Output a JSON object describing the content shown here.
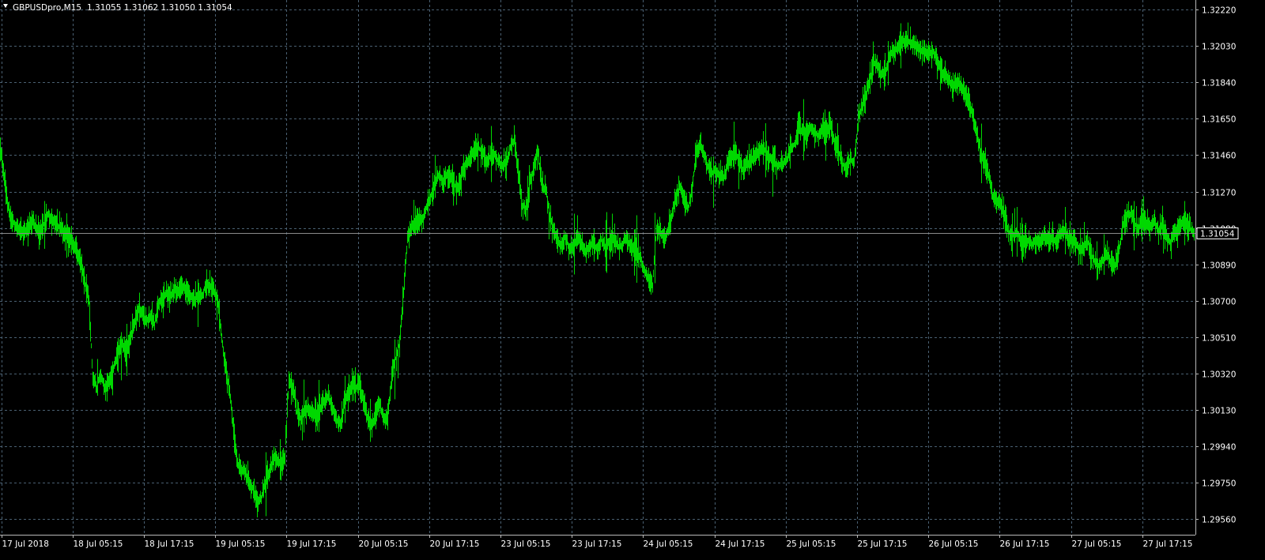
{
  "header": {
    "symbol_timeframe": "GBPUSDpro,M15",
    "ohlc": "1.31055 1.31062 1.31050 1.31054",
    "menu_arrow_icon": "triangle-down-icon"
  },
  "current_price_label": "1.31054",
  "colors": {
    "background": "#000000",
    "bars": "#00d800",
    "grid": "#4a6072",
    "axis": "#b8b8b8",
    "text": "#ffffff",
    "price_tag_bg": "#000000"
  },
  "chart_data": {
    "type": "line",
    "style": "ohlc-bars",
    "timeframe": "M15",
    "title": "GBPUSDpro,M15",
    "grid": true,
    "y_axis": {
      "side": "right",
      "ticks": [
        "1.32220",
        "1.32030",
        "1.31840",
        "1.31650",
        "1.31460",
        "1.31270",
        "1.31080",
        "1.30890",
        "1.30700",
        "1.30510",
        "1.30320",
        "1.30130",
        "1.29940",
        "1.29750",
        "1.29560"
      ],
      "range": [
        1.2953,
        1.3228
      ]
    },
    "x_axis": {
      "ticks": [
        "17 Jul 2018",
        "18 Jul 05:15",
        "18 Jul 17:15",
        "19 Jul 05:15",
        "19 Jul 17:15",
        "20 Jul 05:15",
        "20 Jul 17:15",
        "23 Jul 05:15",
        "23 Jul 17:15",
        "24 Jul 05:15",
        "24 Jul 17:15",
        "25 Jul 05:15",
        "25 Jul 17:15",
        "26 Jul 05:15",
        "26 Jul 17:15",
        "27 Jul 05:15",
        "27 Jul 17:15"
      ]
    },
    "current_price": 1.31054,
    "series": [
      {
        "x": [
          "17 Jul 2018",
          "18 Jul 05:15",
          "18 Jul 17:15",
          "19 Jul 05:15",
          "19 Jul 17:15",
          "20 Jul 05:15",
          "20 Jul 17:15",
          "23 Jul 05:15",
          "23 Jul 17:15",
          "24 Jul 05:15",
          "24 Jul 17:15",
          "25 Jul 05:15",
          "25 Jul 17:15",
          "26 Jul 05:15",
          "26 Jul 17:15",
          "27 Jul 05:15",
          "27 Jul 17:15"
        ],
        "path": [
          [
            0,
            1.315
          ],
          [
            10,
            1.3118
          ],
          [
            20,
            1.3108
          ],
          [
            30,
            1.3105
          ],
          [
            40,
            1.3112
          ],
          [
            50,
            1.3105
          ],
          [
            60,
            1.3115
          ],
          [
            70,
            1.311
          ],
          [
            80,
            1.3106
          ],
          [
            90,
            1.3101
          ],
          [
            100,
            1.3092
          ],
          [
            107,
            1.308
          ],
          [
            112,
            1.307
          ],
          [
            117,
            1.303
          ],
          [
            122,
            1.3025
          ],
          [
            127,
            1.3032
          ],
          [
            132,
            1.3024
          ],
          [
            140,
            1.303
          ],
          [
            145,
            1.3038
          ],
          [
            150,
            1.3045
          ],
          [
            155,
            1.3047
          ],
          [
            160,
            1.3044
          ],
          [
            165,
            1.3052
          ],
          [
            170,
            1.3058
          ],
          [
            175,
            1.3066
          ],
          [
            180,
            1.3062
          ],
          [
            185,
            1.306
          ],
          [
            190,
            1.3062
          ],
          [
            195,
            1.3058
          ],
          [
            200,
            1.3068
          ],
          [
            205,
            1.3072
          ],
          [
            210,
            1.3074
          ],
          [
            215,
            1.3073
          ],
          [
            220,
            1.3075
          ],
          [
            225,
            1.3076
          ],
          [
            230,
            1.3078
          ],
          [
            235,
            1.3075
          ],
          [
            240,
            1.3073
          ],
          [
            245,
            1.307
          ],
          [
            250,
            1.3073
          ],
          [
            255,
            1.3072
          ],
          [
            260,
            1.3079
          ],
          [
            265,
            1.3077
          ],
          [
            270,
            1.3075
          ],
          [
            275,
            1.307
          ],
          [
            280,
            1.305
          ],
          [
            285,
            1.3035
          ],
          [
            290,
            1.3022
          ],
          [
            295,
            1.3003
          ],
          [
            300,
            1.2985
          ],
          [
            305,
            1.2982
          ],
          [
            310,
            1.298
          ],
          [
            315,
            1.2975
          ],
          [
            320,
            1.2972
          ],
          [
            325,
            1.2964
          ],
          [
            330,
            1.2967
          ],
          [
            335,
            1.2975
          ],
          [
            340,
            1.298
          ],
          [
            345,
            1.2988
          ],
          [
            350,
            1.2987
          ],
          [
            355,
            1.2984
          ],
          [
            360,
            1.299
          ],
          [
            365,
            1.3029
          ],
          [
            370,
            1.3025
          ],
          [
            375,
            1.3012
          ],
          [
            380,
            1.3008
          ],
          [
            385,
            1.3012
          ],
          [
            390,
            1.3014
          ],
          [
            395,
            1.3012
          ],
          [
            400,
            1.301
          ],
          [
            405,
            1.3013
          ],
          [
            410,
            1.3018
          ],
          [
            415,
            1.302
          ],
          [
            420,
            1.3014
          ],
          [
            425,
            1.3008
          ],
          [
            430,
            1.3005
          ],
          [
            435,
            1.3016
          ],
          [
            440,
            1.3022
          ],
          [
            445,
            1.3026
          ],
          [
            450,
            1.3025
          ],
          [
            455,
            1.3026
          ],
          [
            460,
            1.3016
          ],
          [
            465,
            1.3008
          ],
          [
            470,
            1.3004
          ],
          [
            475,
            1.3012
          ],
          [
            480,
            1.3016
          ],
          [
            485,
            1.3008
          ],
          [
            490,
            1.301
          ],
          [
            495,
            1.303
          ],
          [
            500,
            1.304
          ],
          [
            505,
            1.3048
          ],
          [
            510,
            1.3075
          ],
          [
            515,
            1.3102
          ],
          [
            520,
            1.3108
          ],
          [
            525,
            1.311
          ],
          [
            530,
            1.3112
          ],
          [
            535,
            1.3113
          ],
          [
            540,
            1.312
          ],
          [
            545,
            1.3125
          ],
          [
            550,
            1.3132
          ],
          [
            555,
            1.3136
          ],
          [
            560,
            1.3132
          ],
          [
            565,
            1.3135
          ],
          [
            570,
            1.3134
          ],
          [
            575,
            1.313
          ],
          [
            580,
            1.3128
          ],
          [
            585,
            1.3138
          ],
          [
            590,
            1.3142
          ],
          [
            595,
            1.3145
          ],
          [
            600,
            1.3148
          ],
          [
            605,
            1.315
          ],
          [
            610,
            1.3147
          ],
          [
            615,
            1.3143
          ],
          [
            620,
            1.3145
          ],
          [
            625,
            1.3147
          ],
          [
            630,
            1.3143
          ],
          [
            635,
            1.314
          ],
          [
            640,
            1.3142
          ],
          [
            645,
            1.315
          ],
          [
            650,
            1.3154
          ],
          [
            655,
            1.3138
          ],
          [
            660,
            1.312
          ],
          [
            665,
            1.3118
          ],
          [
            670,
            1.3132
          ],
          [
            675,
            1.314
          ],
          [
            680,
            1.3148
          ],
          [
            685,
            1.313
          ],
          [
            690,
            1.3128
          ],
          [
            695,
            1.3114
          ],
          [
            700,
            1.3106
          ],
          [
            705,
            1.3102
          ],
          [
            710,
            1.3098
          ],
          [
            715,
            1.3104
          ],
          [
            720,
            1.3096
          ],
          [
            725,
            1.3098
          ],
          [
            730,
            1.3104
          ],
          [
            735,
            1.3099
          ],
          [
            740,
            1.3096
          ],
          [
            745,
            1.3098
          ],
          [
            750,
            1.31
          ],
          [
            755,
            1.3097
          ],
          [
            760,
            1.3102
          ],
          [
            765,
            1.3098
          ],
          [
            770,
            1.31
          ],
          [
            775,
            1.3102
          ],
          [
            780,
            1.3099
          ],
          [
            785,
            1.3098
          ],
          [
            790,
            1.3103
          ],
          [
            795,
            1.31
          ],
          [
            800,
            1.3097
          ],
          [
            805,
            1.3096
          ],
          [
            810,
            1.3092
          ],
          [
            815,
            1.3085
          ],
          [
            820,
            1.3082
          ],
          [
            825,
            1.3078
          ],
          [
            830,
            1.3108
          ],
          [
            835,
            1.3106
          ],
          [
            840,
            1.3102
          ],
          [
            845,
            1.3108
          ],
          [
            850,
            1.3116
          ],
          [
            855,
            1.3125
          ],
          [
            860,
            1.313
          ],
          [
            865,
            1.3122
          ],
          [
            870,
            1.3118
          ],
          [
            875,
            1.3128
          ],
          [
            880,
            1.3148
          ],
          [
            885,
            1.3152
          ],
          [
            890,
            1.3146
          ],
          [
            895,
            1.314
          ],
          [
            900,
            1.3136
          ],
          [
            905,
            1.3138
          ],
          [
            910,
            1.3136
          ],
          [
            915,
            1.3134
          ],
          [
            920,
            1.3142
          ],
          [
            925,
            1.3146
          ],
          [
            930,
            1.3148
          ],
          [
            935,
            1.3142
          ],
          [
            940,
            1.3138
          ],
          [
            945,
            1.3142
          ],
          [
            950,
            1.3144
          ],
          [
            955,
            1.3146
          ],
          [
            960,
            1.3148
          ],
          [
            965,
            1.315
          ],
          [
            970,
            1.3146
          ],
          [
            975,
            1.3144
          ],
          [
            980,
            1.3142
          ],
          [
            985,
            1.314
          ],
          [
            990,
            1.3142
          ],
          [
            995,
            1.3144
          ],
          [
            1000,
            1.315
          ],
          [
            1005,
            1.3152
          ],
          [
            1010,
            1.3162
          ],
          [
            1015,
            1.3158
          ],
          [
            1020,
            1.3156
          ],
          [
            1025,
            1.316
          ],
          [
            1030,
            1.3158
          ],
          [
            1035,
            1.3156
          ],
          [
            1040,
            1.316
          ],
          [
            1045,
            1.3158
          ],
          [
            1050,
            1.3162
          ],
          [
            1055,
            1.3152
          ],
          [
            1060,
            1.3148
          ],
          [
            1065,
            1.3142
          ],
          [
            1070,
            1.3138
          ],
          [
            1075,
            1.3144
          ],
          [
            1080,
            1.3142
          ],
          [
            1085,
            1.3165
          ],
          [
            1090,
            1.3172
          ],
          [
            1095,
            1.3178
          ],
          [
            1100,
            1.3186
          ],
          [
            1105,
            1.3194
          ],
          [
            1110,
            1.3192
          ],
          [
            1115,
            1.3188
          ],
          [
            1120,
            1.319
          ],
          [
            1125,
            1.3198
          ],
          [
            1130,
            1.32
          ],
          [
            1135,
            1.3202
          ],
          [
            1140,
            1.3205
          ],
          [
            1145,
            1.3207
          ],
          [
            1150,
            1.3205
          ],
          [
            1155,
            1.3204
          ],
          [
            1160,
            1.3203
          ],
          [
            1165,
            1.3201
          ],
          [
            1170,
            1.32
          ],
          [
            1175,
            1.3199
          ],
          [
            1180,
            1.32
          ],
          [
            1185,
            1.3196
          ],
          [
            1190,
            1.319
          ],
          [
            1195,
            1.3188
          ],
          [
            1200,
            1.3185
          ],
          [
            1205,
            1.3182
          ],
          [
            1210,
            1.3184
          ],
          [
            1215,
            1.3182
          ],
          [
            1220,
            1.3178
          ],
          [
            1225,
            1.3174
          ],
          [
            1230,
            1.3166
          ],
          [
            1235,
            1.3158
          ],
          [
            1240,
            1.3146
          ],
          [
            1245,
            1.3142
          ],
          [
            1250,
            1.3136
          ],
          [
            1255,
            1.3125
          ],
          [
            1260,
            1.3122
          ],
          [
            1265,
            1.312
          ],
          [
            1270,
            1.3114
          ],
          [
            1275,
            1.3106
          ],
          [
            1280,
            1.3104
          ],
          [
            1285,
            1.3106
          ],
          [
            1290,
            1.3102
          ],
          [
            1295,
            1.3101
          ],
          [
            1300,
            1.3102
          ],
          [
            1305,
            1.31
          ],
          [
            1310,
            1.3102
          ],
          [
            1315,
            1.31
          ],
          [
            1320,
            1.3104
          ],
          [
            1325,
            1.3102
          ],
          [
            1330,
            1.3103
          ],
          [
            1335,
            1.3101
          ],
          [
            1340,
            1.3104
          ],
          [
            1345,
            1.3106
          ],
          [
            1350,
            1.3103
          ],
          [
            1355,
            1.3102
          ],
          [
            1360,
            1.31
          ],
          [
            1365,
            1.3096
          ],
          [
            1370,
            1.3098
          ],
          [
            1375,
            1.3102
          ],
          [
            1380,
            1.3094
          ],
          [
            1385,
            1.309
          ],
          [
            1390,
            1.3088
          ],
          [
            1395,
            1.3092
          ],
          [
            1400,
            1.3094
          ],
          [
            1405,
            1.309
          ],
          [
            1410,
            1.3088
          ],
          [
            1415,
            1.3096
          ],
          [
            1420,
            1.311
          ],
          [
            1425,
            1.3114
          ],
          [
            1430,
            1.3116
          ],
          [
            1435,
            1.311
          ],
          [
            1440,
            1.3108
          ],
          [
            1445,
            1.3112
          ],
          [
            1450,
            1.311
          ],
          [
            1455,
            1.3108
          ],
          [
            1460,
            1.3112
          ],
          [
            1465,
            1.3106
          ],
          [
            1470,
            1.311
          ],
          [
            1475,
            1.3104
          ],
          [
            1480,
            1.31
          ],
          [
            1485,
            1.3106
          ],
          [
            1490,
            1.3108
          ],
          [
            1495,
            1.3112
          ],
          [
            1500,
            1.311
          ],
          [
            1505,
            1.3108
          ],
          [
            1510,
            1.3105
          ]
        ]
      }
    ]
  }
}
